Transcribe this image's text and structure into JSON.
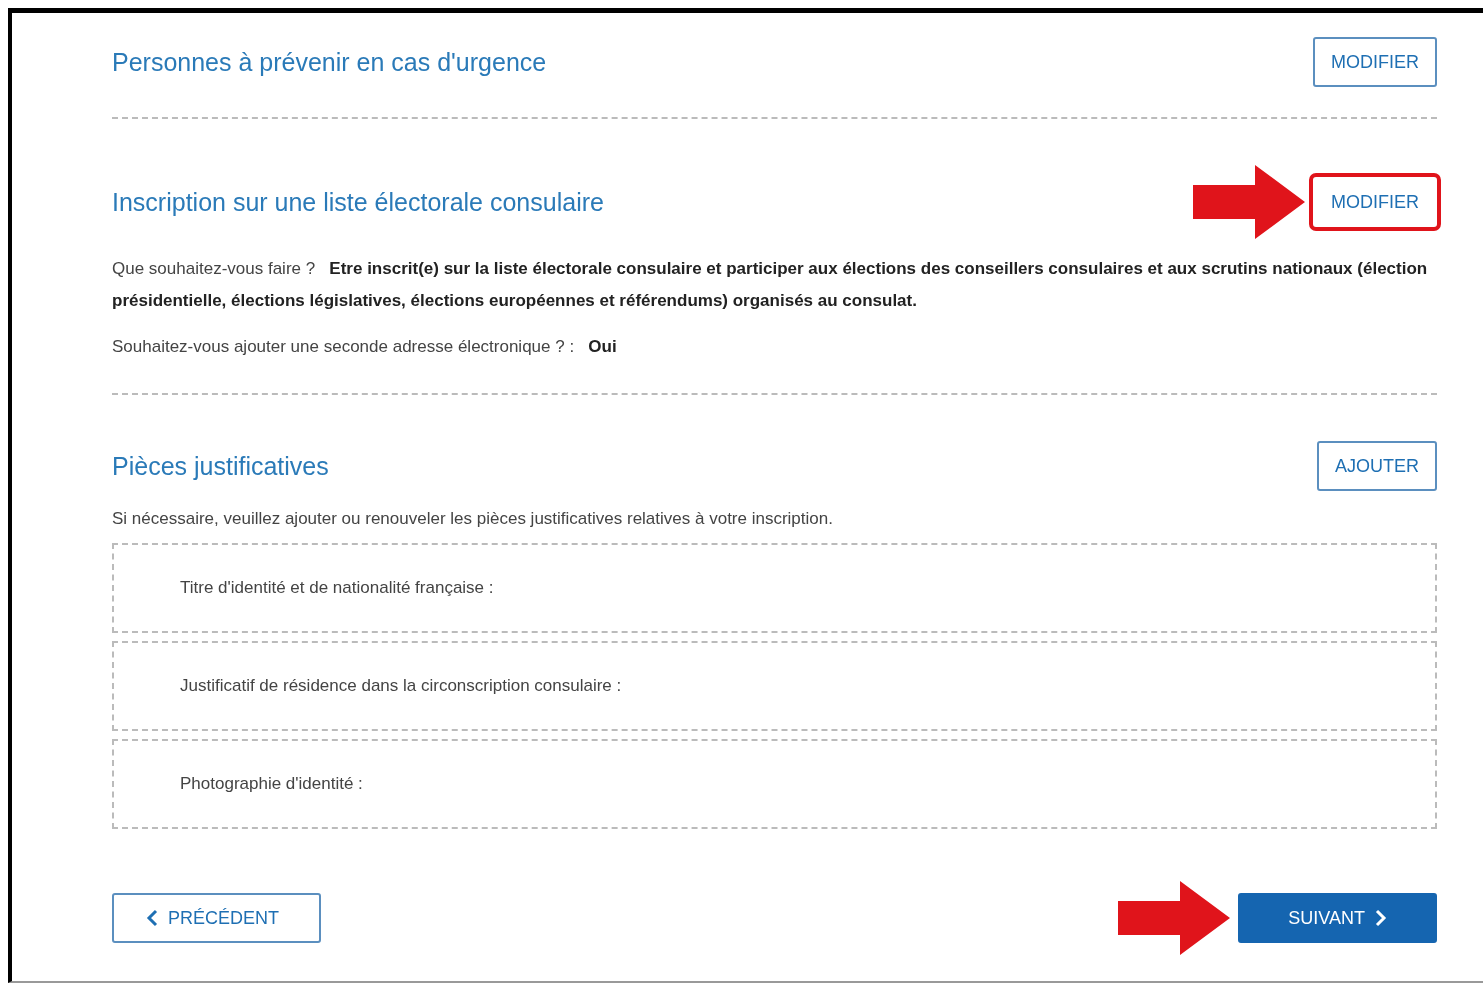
{
  "sections": [
    {
      "title": "Personnes à prévenir en cas d'urgence",
      "button": {
        "label": "MODIFIER",
        "highlighted": false
      }
    },
    {
      "title": "Inscription sur une liste électorale consulaire",
      "button": {
        "label": "MODIFIER",
        "highlighted": true
      },
      "fields": [
        {
          "label": "Que souhaitez-vous faire ?",
          "value": "Etre inscrit(e) sur la liste électorale consulaire et participer aux élections des conseillers consulaires et aux scrutins nationaux (élection présidentielle, élections législatives, élections européennes et référendums) organisés au consulat."
        },
        {
          "label": "Souhaitez-vous ajouter une seconde adresse électronique ? :",
          "value": "Oui"
        }
      ]
    },
    {
      "title": "Pièces justificatives",
      "button": {
        "label": "AJOUTER",
        "highlighted": false
      },
      "description": "Si nécessaire, veuillez ajouter ou renouveler les pièces justificatives relatives à votre inscription.",
      "documents": [
        {
          "label": "Titre d'identité et de nationalité française :"
        },
        {
          "label": "Justificatif de résidence dans la circonscription consulaire :"
        },
        {
          "label": "Photographie d'identité :"
        }
      ]
    }
  ],
  "footer": {
    "previous": {
      "label": "PRÉCÉDENT"
    },
    "next": {
      "label": "SUIVANT",
      "highlighted": true
    }
  }
}
